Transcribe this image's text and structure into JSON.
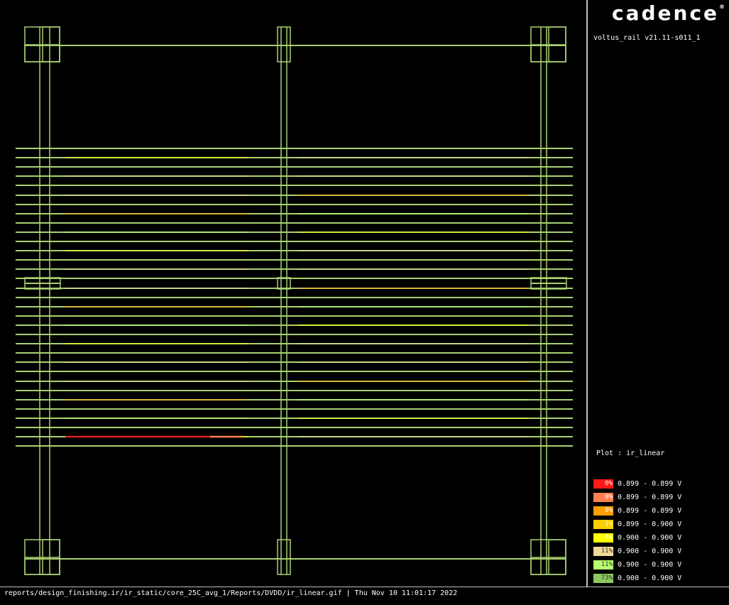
{
  "app": {
    "logo_text": "cadence",
    "logo_mark": "®",
    "version": "voltus_rail v21.11-s011_1"
  },
  "plot": {
    "label": "Plot : ir_linear",
    "grid_color": "#a8d070"
  },
  "legend": [
    {
      "pct": "0%",
      "range": "0.899 - 0.899 V",
      "color": "#ff1a1a"
    },
    {
      "pct": "0%",
      "range": "0.899 - 0.899 V",
      "color": "#ff7f50"
    },
    {
      "pct": "0%",
      "range": "0.899 - 0.899 V",
      "color": "#ff9f00"
    },
    {
      "pct": "1%",
      "range": "0.899 - 0.900 V",
      "color": "#ffd000"
    },
    {
      "pct": "4%",
      "range": "0.900 - 0.900 V",
      "color": "#ffff00"
    },
    {
      "pct": "11%",
      "range": "0.900 - 0.900 V",
      "color": "#f0d898"
    },
    {
      "pct": "11%",
      "range": "0.900 - 0.900 V",
      "color": "#b8ff70"
    },
    {
      "pct": "73%",
      "range": "0.900 - 0.900 V",
      "color": "#8cc860"
    }
  ],
  "status": {
    "text": "reports/design_finishing.ir/ir_static/core_25C_avg_1/Reports/DVDD/ir_linear.gif | Thu Nov 10 11:01:17 2022"
  }
}
